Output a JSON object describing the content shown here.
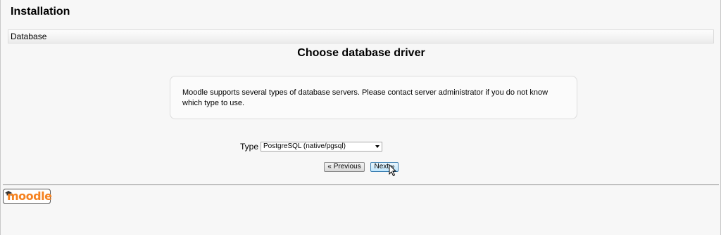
{
  "header": {
    "title": "Installation"
  },
  "breadcrumb": {
    "label": "Database"
  },
  "main": {
    "title": "Choose database driver",
    "info_text": "Moodle supports several types of database servers. Please contact server administrator if you do not know which type to use.",
    "type_label": "Type",
    "type_selected": "PostgreSQL (native/pgsql)"
  },
  "buttons": {
    "previous_label": "« Previous",
    "next_label": "Next »"
  },
  "footer": {
    "logo_text": "moodle",
    "logo_icon": "graduation-cap-icon"
  },
  "colors": {
    "logo_orange": "#f58220",
    "next_button_border": "#3c7fb1"
  }
}
